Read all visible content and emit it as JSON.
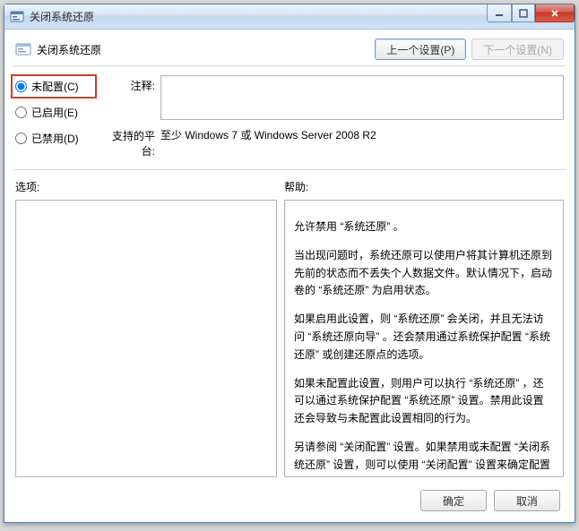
{
  "window": {
    "title": "关闭系统还原"
  },
  "header": {
    "heading": "关闭系统还原",
    "prev_btn": "上一个设置(P)",
    "next_btn": "下一个设置(N)"
  },
  "radios": {
    "not_configured": "未配置(C)",
    "enabled": "已启用(E)",
    "disabled": "已禁用(D)",
    "selected": "not_configured"
  },
  "labels": {
    "comment": "注释:",
    "platform": "支持的平台:",
    "options": "选项:",
    "help": "帮助:"
  },
  "platform_text": "至少 Windows 7 或 Windows Server 2008 R2",
  "comment_value": "",
  "options_content": "",
  "help": {
    "p1": "允许禁用 “系统还原” 。",
    "p2": "当出现问题时，系统还原可以使用户将其计算机还原到先前的状态而不丢失个人数据文件。默认情况下，启动卷的 “系统还原” 为启用状态。",
    "p3": "如果启用此设置，则 “系统还原” 会关闭，并且无法访问 “系统还原向导” 。还会禁用通过系统保护配置 “系统还原” 或创建还原点的选项。",
    "p4": "如果未配置此设置，则用户可以执行 “系统还原” ，还可以通过系统保护配置 “系统还原” 设置。禁用此设置还会导致与未配置此设置相同的行为。",
    "p5": "另请参阅 “关闭配置” 设置。如果禁用或未配置 “关闭系统还原” 设置，则可以使用 “关闭配置” 设置来确定配置 “系统还原” 的选项是否可用。"
  },
  "footer": {
    "ok": "确定",
    "cancel": "取消"
  }
}
